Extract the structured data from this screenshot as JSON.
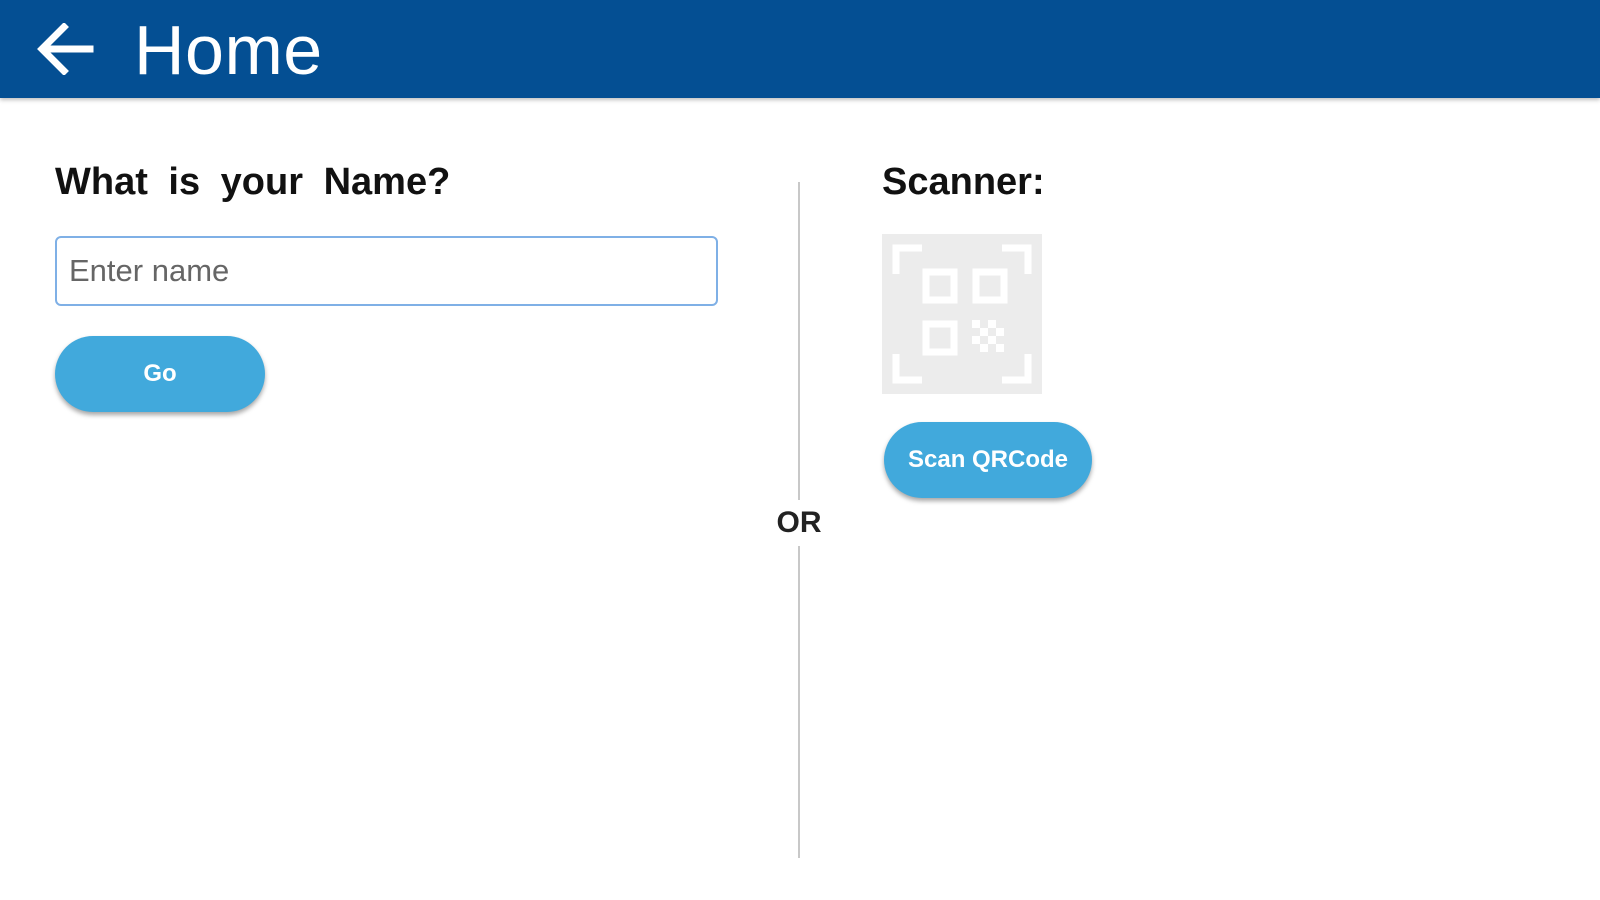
{
  "toolbar": {
    "title": "Home",
    "background_color": "#044f93",
    "back_icon": "arrow-left-icon"
  },
  "name_section": {
    "question": "What is your Name?",
    "input_value": "",
    "input_placeholder": "Enter name",
    "go_button_label": "Go"
  },
  "separator": {
    "or_label": "OR"
  },
  "scanner_section": {
    "label": "Scanner:",
    "qr_icon": "qr-code-icon",
    "scan_button_label": "Scan QRCode"
  },
  "colors": {
    "accent_button": "#41a9dc",
    "input_border": "#7fb0e6"
  }
}
